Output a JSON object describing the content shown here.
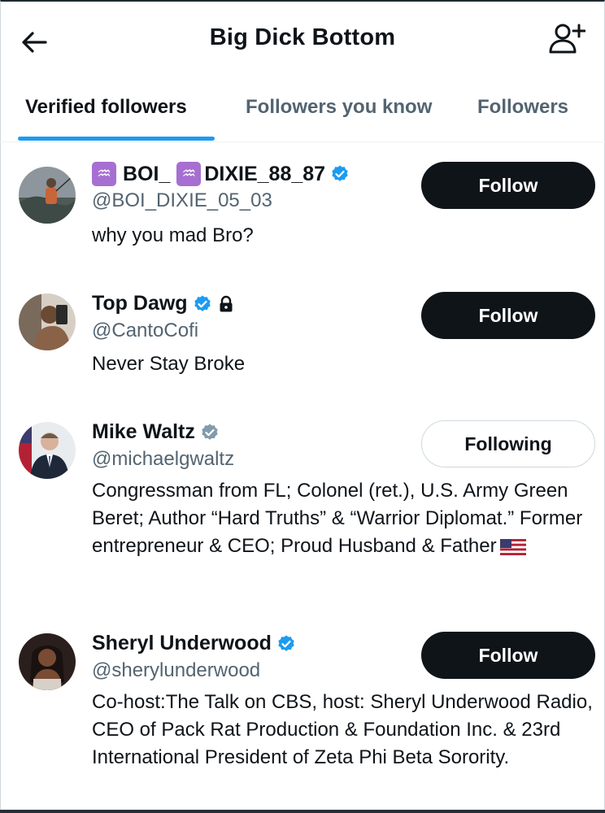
{
  "header": {
    "title": "Big Dick Bottom"
  },
  "tabs": [
    {
      "label": "Verified followers"
    },
    {
      "label": "Followers you know"
    },
    {
      "label": "Followers"
    }
  ],
  "users": [
    {
      "name_part1": "BOI_",
      "name_part2": "DIXIE_88_87",
      "handle": "@BOI_DIXIE_05_03",
      "bio": "why you mad Bro?",
      "button": "Follow",
      "badge_color": "#1d9bf0",
      "name_icon": "aquarius-emoji"
    },
    {
      "name": "Top Dawg",
      "handle": "@CantoCofi",
      "bio": "Never Stay Broke",
      "button": "Follow",
      "badge_color": "#1d9bf0",
      "extra_icon": "lock-icon"
    },
    {
      "name": "Mike Waltz",
      "handle": "@michaelgwaltz",
      "bio": "Congressman from FL; Colonel (ret.), U.S. Army Green Beret; Author “Hard Truths” & “Warrior Diplomat.” Former entrepreneur & CEO; Proud Husband & Father",
      "bio_icon": "us-flag-emoji",
      "button": "Following",
      "badge_color": "#829aab"
    },
    {
      "name": "Sheryl Underwood",
      "handle": "@sherylunderwood",
      "bio": "Co-host:The Talk on CBS, host: Sheryl Underwood Radio, CEO of Pack Rat Production & Foundation Inc. & 23rd International President of Zeta Phi Beta Sorority.",
      "button": "Follow",
      "badge_color": "#1d9bf0"
    }
  ]
}
